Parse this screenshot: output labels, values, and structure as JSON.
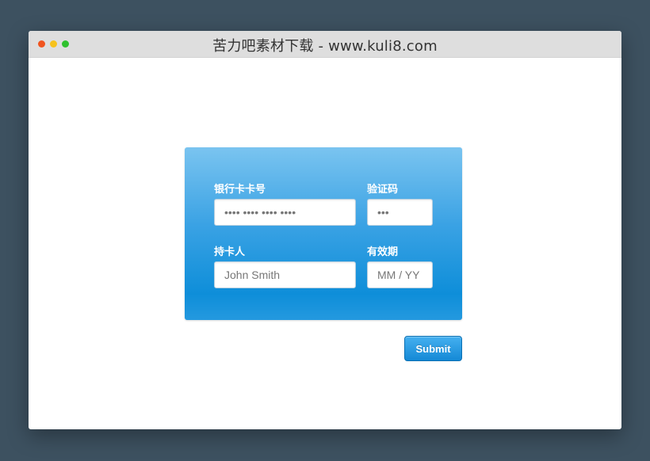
{
  "window": {
    "title": "苦力吧素材下载 - www.kuli8.com"
  },
  "form": {
    "card_number": {
      "label": "银行卡卡号",
      "placeholder": "•••• •••• •••• ••••"
    },
    "cvc": {
      "label": "验证码",
      "placeholder": "•••"
    },
    "cardholder": {
      "label": "持卡人",
      "placeholder": "John Smith"
    },
    "expiry": {
      "label": "有效期",
      "placeholder": "MM / YY"
    },
    "submit_label": "Submit"
  },
  "colors": {
    "background": "#3d5160",
    "card_top": "#7ac4f0",
    "card_bottom": "#0e8ed9",
    "button": "#1489d6",
    "dot_red": "#f0541e",
    "dot_yellow": "#f6c21c",
    "dot_green": "#2fc12e"
  }
}
